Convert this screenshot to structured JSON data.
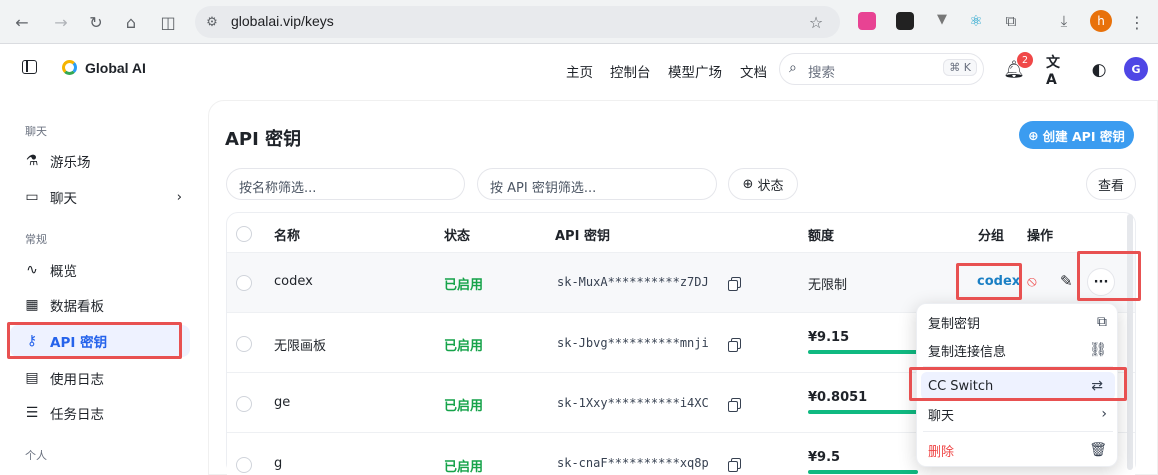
{
  "browser": {
    "url": "globalai.vip/keys",
    "profile_initial": "h"
  },
  "header": {
    "brand": "Global AI",
    "nav": [
      "主页",
      "控制台",
      "模型广场",
      "文档"
    ],
    "search_placeholder": "搜索",
    "search_shortcut": "⌘ K",
    "notification_count": "2",
    "avatar_initial": "G"
  },
  "sidebar": {
    "sections": [
      {
        "title": "聊天",
        "items": [
          {
            "label": "游乐场",
            "icon": "flask-icon"
          },
          {
            "label": "聊天",
            "icon": "chat-icon"
          }
        ]
      },
      {
        "title": "常规",
        "items": [
          {
            "label": "概览",
            "icon": "activity-icon"
          },
          {
            "label": "数据看板",
            "icon": "dashboard-icon"
          },
          {
            "label": "API 密钥",
            "icon": "key-icon"
          },
          {
            "label": "使用日志",
            "icon": "log-icon"
          },
          {
            "label": "任务日志",
            "icon": "task-list-icon"
          }
        ]
      },
      {
        "title": "个人",
        "items": []
      }
    ]
  },
  "main": {
    "title": "API 密钥",
    "create_button": "创建 API 密钥",
    "filter_name_placeholder": "按名称筛选...",
    "filter_key_placeholder": "按 API 密钥筛选...",
    "status_button": "状态",
    "view_button": "查看",
    "table": {
      "columns": [
        "名称",
        "状态",
        "API 密钥",
        "额度",
        "分组",
        "操作"
      ],
      "rows": [
        {
          "name": "codex",
          "status": "已启用",
          "key": "sk-MuxA**********z7DJ",
          "quota": "无限制",
          "group": "codex"
        },
        {
          "name": "无限画板",
          "status": "已启用",
          "key": "sk-Jbvg**********mnji",
          "quota": "¥9.15",
          "quota_fraction": 0.92
        },
        {
          "name": "ge",
          "status": "已启用",
          "key": "sk-1Xxy**********i4XC",
          "quota": "¥0.8051",
          "quota_fraction": 0.92
        },
        {
          "name": "g",
          "status": "已启用",
          "key": "sk-cnaF**********xq8p",
          "quota": "¥9.5",
          "quota_fraction": 0.92
        }
      ]
    }
  },
  "dropdown": {
    "items": [
      {
        "label": "复制密钥",
        "icon": "copy-icon"
      },
      {
        "label": "复制连接信息",
        "icon": "link-icon"
      },
      {
        "label": "CC Switch",
        "icon": "switch-arrows-icon"
      },
      {
        "label": "聊天",
        "icon": "chevron-right-icon"
      },
      {
        "label": "删除",
        "icon": "trash-icon"
      }
    ]
  },
  "colors": {
    "accent": "#3b9cf0",
    "enabled_status": "#16a34a",
    "highlight": "#e85151",
    "danger": "#ef4444"
  }
}
